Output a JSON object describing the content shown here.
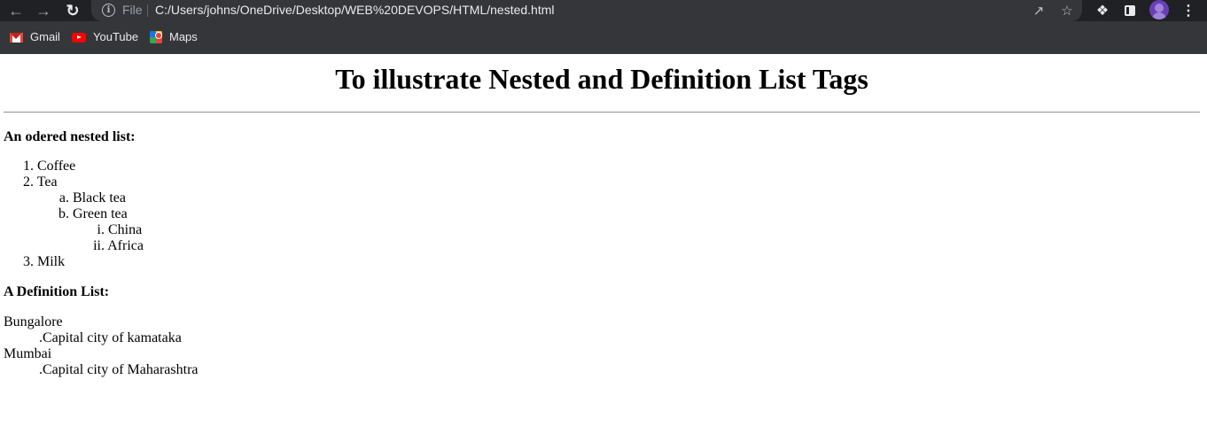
{
  "browser": {
    "file_label": "File",
    "url": "C:/Users/johns/OneDrive/Desktop/WEB%20DEVOPS/HTML/nested.html",
    "bookmarks": [
      {
        "label": "Gmail",
        "icon": "gmail-icon"
      },
      {
        "label": "YouTube",
        "icon": "youtube-icon"
      },
      {
        "label": "Maps",
        "icon": "maps-icon"
      }
    ]
  },
  "page": {
    "title": "To illustrate Nested and Definition List Tags",
    "ordered_heading": "An odered nested list:",
    "ordered_list": [
      {
        "marker": "1.",
        "text": "Coffee"
      },
      {
        "marker": "2.",
        "text": "Tea"
      },
      {
        "marker": "a.",
        "text": "Black tea"
      },
      {
        "marker": "b.",
        "text": "Green tea"
      },
      {
        "marker": "i.",
        "text": "China"
      },
      {
        "marker": "ii.",
        "text": "Africa"
      },
      {
        "marker": "3.",
        "text": "Milk"
      }
    ],
    "definition_heading": "A Definition List:",
    "definitions": [
      {
        "term": "Bungalore",
        "desc": ".Capital city of kamataka"
      },
      {
        "term": "Mumbai",
        "desc": ".Capital city of Maharashtra"
      }
    ]
  }
}
